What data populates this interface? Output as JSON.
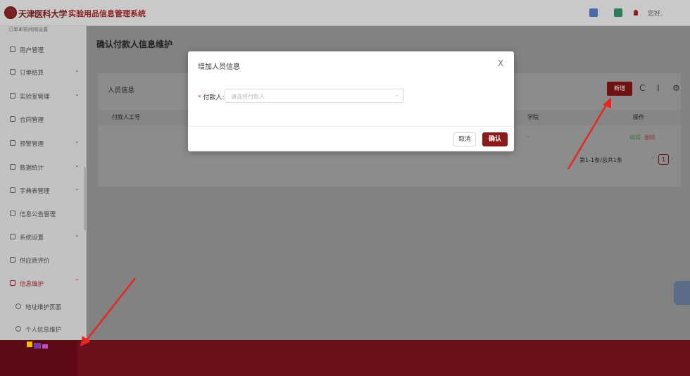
{
  "header": {
    "school_name": "天津医科大学",
    "system_title": "实验用品信息管理系统",
    "greeting": "您好,"
  },
  "sidebar": {
    "top_partial": "订单审核间隔设置",
    "items": [
      {
        "label": "用户管理",
        "icon": "user-icon",
        "chevron": ""
      },
      {
        "label": "订单结算",
        "icon": "clock-icon",
        "chevron": "⌄"
      },
      {
        "label": "实验室管理",
        "icon": "location-icon",
        "chevron": "⌄"
      },
      {
        "label": "合同管理",
        "icon": "document-icon",
        "chevron": ""
      },
      {
        "label": "预警管理",
        "icon": "warning-icon",
        "chevron": "⌄"
      },
      {
        "label": "数据统计",
        "icon": "chart-icon",
        "chevron": "⌄"
      },
      {
        "label": "字典表管理",
        "icon": "book-icon",
        "chevron": "⌄"
      },
      {
        "label": "信息公告管理",
        "icon": "bell-icon",
        "chevron": ""
      },
      {
        "label": "系统设置",
        "icon": "settings-icon",
        "chevron": "⌄"
      },
      {
        "label": "供应商评价",
        "icon": "star-icon",
        "chevron": ""
      },
      {
        "label": "信息维护",
        "icon": "info-icon",
        "chevron": "⌃"
      }
    ],
    "sub_items": [
      {
        "label": "地址维护页面"
      },
      {
        "label": "个人信息维护"
      }
    ]
  },
  "main": {
    "page_title": "确认付款人信息维护",
    "card_title": "人员信息",
    "new_button": "新增",
    "refresh_icon": "C",
    "column_icon": "I",
    "settings_icon": "⚙",
    "columns": [
      "付款人工号",
      "学院",
      "操作"
    ],
    "row": {
      "college": "-",
      "edit": "编辑",
      "delete": "删除"
    },
    "pagination": {
      "summary": "第1-1条/总共1条",
      "current": "1",
      "prev": "‹",
      "next": "›"
    }
  },
  "modal": {
    "title": "增加人员信息",
    "close": "X",
    "required_mark": "*",
    "field_label": "付款人:",
    "placeholder": "请选择付款人",
    "cancel_label": "取消",
    "confirm_label": "确认"
  },
  "colors": {
    "brand": "#8b1a1a",
    "footer": "#6b0f1a",
    "annotation_arrow": "#e8251f"
  }
}
